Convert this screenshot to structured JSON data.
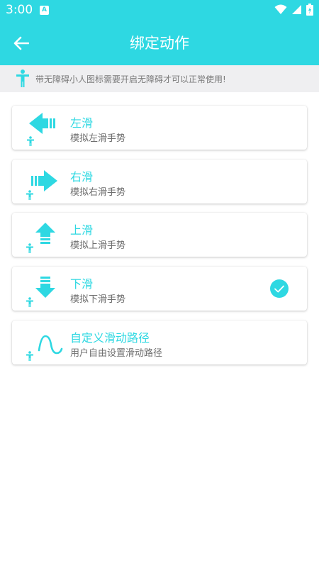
{
  "status_bar": {
    "time": "3:00",
    "notification_icon": "a-icon",
    "wifi_icon": "wifi-icon",
    "signal_icon": "signal-icon",
    "battery_icon": "battery-icon"
  },
  "header": {
    "title": "绑定动作",
    "back_icon": "back-arrow-icon",
    "color": "#2ed8e2"
  },
  "notice": {
    "icon": "accessibility-person-icon",
    "text": "带无障碍小人图标需要开启无障碍才可以正常使用!"
  },
  "actions": [
    {
      "title": "左滑",
      "subtitle": "模拟左滑手势",
      "icon": "swipe-left-arrow-icon",
      "selected": false
    },
    {
      "title": "右滑",
      "subtitle": "模拟右滑手势",
      "icon": "swipe-right-arrow-icon",
      "selected": false
    },
    {
      "title": "上滑",
      "subtitle": "模拟上滑手势",
      "icon": "swipe-up-arrow-icon",
      "selected": false
    },
    {
      "title": "下滑",
      "subtitle": "模拟下滑手势",
      "icon": "swipe-down-arrow-icon",
      "selected": true
    },
    {
      "title": "自定义滑动路径",
      "subtitle": "用户自由设置滑动路径",
      "icon": "custom-path-wave-icon",
      "selected": false
    }
  ],
  "colors": {
    "accent": "#2ed8e2",
    "subtitle": "#6e6e6e",
    "notice_bg": "#efeff1"
  }
}
